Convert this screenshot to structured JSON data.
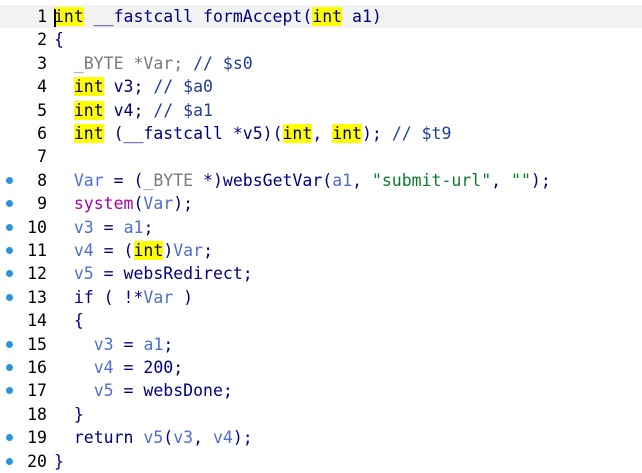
{
  "editor": {
    "colors": {
      "breakpoint": "#2b93d9",
      "highlight": "#ffff00",
      "keyword": "#000080",
      "variable": "#4d6fd1",
      "string": "#0d7a2a",
      "comment": "#1e3e98",
      "call": "#aa00aa"
    },
    "lines": [
      {
        "num": "1",
        "bp": false,
        "current": true,
        "tokens": [
          {
            "t": "int",
            "c": "t-kw t-hl"
          },
          {
            "t": " __fastcall formAccept(",
            "c": "t-plain"
          },
          {
            "t": "int",
            "c": "t-kw t-hl"
          },
          {
            "t": " a1)",
            "c": "t-plain"
          }
        ]
      },
      {
        "num": "2",
        "bp": false,
        "tokens": [
          {
            "t": "{",
            "c": "t-plain"
          }
        ]
      },
      {
        "num": "3",
        "bp": false,
        "tokens": [
          {
            "t": "  _BYTE *Var; ",
            "c": "t-kwgray"
          },
          {
            "t": "// $s0",
            "c": "t-cmt"
          }
        ]
      },
      {
        "num": "4",
        "bp": false,
        "tokens": [
          {
            "t": "  ",
            "c": "t-plain"
          },
          {
            "t": "int",
            "c": "t-kw t-hl"
          },
          {
            "t": " v3; ",
            "c": "t-plain"
          },
          {
            "t": "// $a0",
            "c": "t-cmt"
          }
        ]
      },
      {
        "num": "5",
        "bp": false,
        "tokens": [
          {
            "t": "  ",
            "c": "t-plain"
          },
          {
            "t": "int",
            "c": "t-kw t-hl"
          },
          {
            "t": " v4; ",
            "c": "t-plain"
          },
          {
            "t": "// $a1",
            "c": "t-cmt"
          }
        ]
      },
      {
        "num": "6",
        "bp": false,
        "tokens": [
          {
            "t": "  ",
            "c": "t-plain"
          },
          {
            "t": "int",
            "c": "t-kw t-hl"
          },
          {
            "t": " (__fastcall *v5)(",
            "c": "t-plain"
          },
          {
            "t": "int",
            "c": "t-kw t-hl"
          },
          {
            "t": ", ",
            "c": "t-plain"
          },
          {
            "t": "int",
            "c": "t-kw t-hl"
          },
          {
            "t": "); ",
            "c": "t-plain"
          },
          {
            "t": "// $t9",
            "c": "t-cmt"
          }
        ]
      },
      {
        "num": "7",
        "bp": false,
        "tokens": []
      },
      {
        "num": "8",
        "bp": true,
        "tokens": [
          {
            "t": "  ",
            "c": "t-plain"
          },
          {
            "t": "Var",
            "c": "t-var"
          },
          {
            "t": " = (",
            "c": "t-plain"
          },
          {
            "t": "_BYTE",
            "c": "t-kwgray"
          },
          {
            "t": " *)websGetVar(",
            "c": "t-plain"
          },
          {
            "t": "a1",
            "c": "t-var"
          },
          {
            "t": ", ",
            "c": "t-plain"
          },
          {
            "t": "\"submit-url\"",
            "c": "t-str"
          },
          {
            "t": ", ",
            "c": "t-plain"
          },
          {
            "t": "\"\"",
            "c": "t-str"
          },
          {
            "t": ");",
            "c": "t-plain"
          }
        ]
      },
      {
        "num": "9",
        "bp": true,
        "tokens": [
          {
            "t": "  ",
            "c": "t-plain"
          },
          {
            "t": "system",
            "c": "t-call"
          },
          {
            "t": "(",
            "c": "t-plain"
          },
          {
            "t": "Var",
            "c": "t-var"
          },
          {
            "t": ");",
            "c": "t-plain"
          }
        ]
      },
      {
        "num": "10",
        "bp": true,
        "tokens": [
          {
            "t": "  ",
            "c": "t-plain"
          },
          {
            "t": "v3",
            "c": "t-var"
          },
          {
            "t": " = ",
            "c": "t-plain"
          },
          {
            "t": "a1",
            "c": "t-var"
          },
          {
            "t": ";",
            "c": "t-plain"
          }
        ]
      },
      {
        "num": "11",
        "bp": true,
        "tokens": [
          {
            "t": "  ",
            "c": "t-plain"
          },
          {
            "t": "v4",
            "c": "t-var"
          },
          {
            "t": " = (",
            "c": "t-plain"
          },
          {
            "t": "int",
            "c": "t-kw t-hl"
          },
          {
            "t": ")",
            "c": "t-plain"
          },
          {
            "t": "Var",
            "c": "t-var"
          },
          {
            "t": ";",
            "c": "t-plain"
          }
        ]
      },
      {
        "num": "12",
        "bp": true,
        "tokens": [
          {
            "t": "  ",
            "c": "t-plain"
          },
          {
            "t": "v5",
            "c": "t-var"
          },
          {
            "t": " = websRedirect;",
            "c": "t-plain"
          }
        ]
      },
      {
        "num": "13",
        "bp": true,
        "tokens": [
          {
            "t": "  if ( !*",
            "c": "t-plain"
          },
          {
            "t": "Var",
            "c": "t-var"
          },
          {
            "t": " )",
            "c": "t-plain"
          }
        ]
      },
      {
        "num": "14",
        "bp": false,
        "tokens": [
          {
            "t": "  {",
            "c": "t-plain"
          }
        ]
      },
      {
        "num": "15",
        "bp": true,
        "tokens": [
          {
            "t": "    ",
            "c": "t-plain"
          },
          {
            "t": "v3",
            "c": "t-var"
          },
          {
            "t": " = ",
            "c": "t-plain"
          },
          {
            "t": "a1",
            "c": "t-var"
          },
          {
            "t": ";",
            "c": "t-plain"
          }
        ]
      },
      {
        "num": "16",
        "bp": true,
        "tokens": [
          {
            "t": "    ",
            "c": "t-plain"
          },
          {
            "t": "v4",
            "c": "t-var"
          },
          {
            "t": " = 200;",
            "c": "t-plain"
          }
        ]
      },
      {
        "num": "17",
        "bp": true,
        "tokens": [
          {
            "t": "    ",
            "c": "t-plain"
          },
          {
            "t": "v5",
            "c": "t-var"
          },
          {
            "t": " = websDone;",
            "c": "t-plain"
          }
        ]
      },
      {
        "num": "18",
        "bp": false,
        "tokens": [
          {
            "t": "  }",
            "c": "t-plain"
          }
        ]
      },
      {
        "num": "19",
        "bp": true,
        "tokens": [
          {
            "t": "  return ",
            "c": "t-plain"
          },
          {
            "t": "v5",
            "c": "t-var"
          },
          {
            "t": "(",
            "c": "t-plain"
          },
          {
            "t": "v3",
            "c": "t-var"
          },
          {
            "t": ", ",
            "c": "t-plain"
          },
          {
            "t": "v4",
            "c": "t-var"
          },
          {
            "t": ");",
            "c": "t-plain"
          }
        ]
      },
      {
        "num": "20",
        "bp": true,
        "tokens": [
          {
            "t": "}",
            "c": "t-plain"
          }
        ]
      }
    ]
  }
}
